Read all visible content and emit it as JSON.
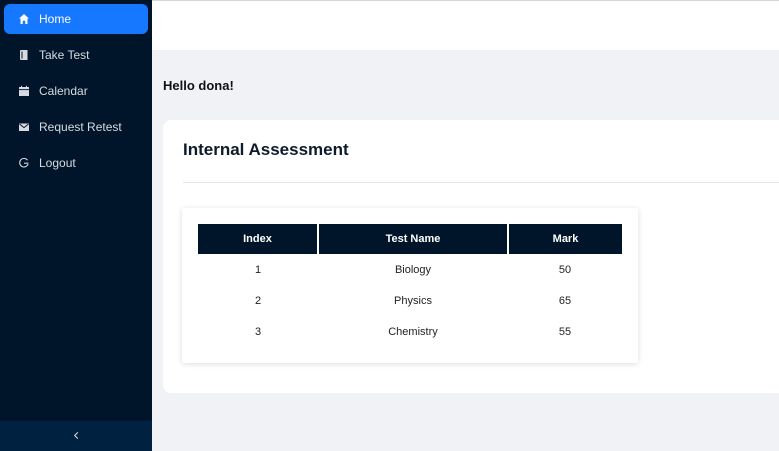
{
  "sidebar": {
    "items": [
      {
        "label": "Home",
        "icon": "home-icon",
        "active": true
      },
      {
        "label": "Take Test",
        "icon": "book-icon",
        "active": false
      },
      {
        "label": "Calendar",
        "icon": "calendar-icon",
        "active": false
      },
      {
        "label": "Request Retest",
        "icon": "mail-icon",
        "active": false
      },
      {
        "label": "Logout",
        "icon": "logout-icon",
        "active": false
      }
    ],
    "collapse_icon": "chevron-left-icon"
  },
  "main": {
    "greeting": "Hello dona!",
    "card": {
      "title": "Internal Assessment",
      "table": {
        "headers": [
          "Index",
          "Test Name",
          "Mark"
        ],
        "rows": [
          [
            "1",
            "Biology",
            "50"
          ],
          [
            "2",
            "Physics",
            "65"
          ],
          [
            "3",
            "Chemistry",
            "55"
          ]
        ]
      }
    }
  },
  "colors": {
    "sidebar_bg": "#001529",
    "accent": "#1677ff",
    "page_bg": "#f0f2f5"
  }
}
